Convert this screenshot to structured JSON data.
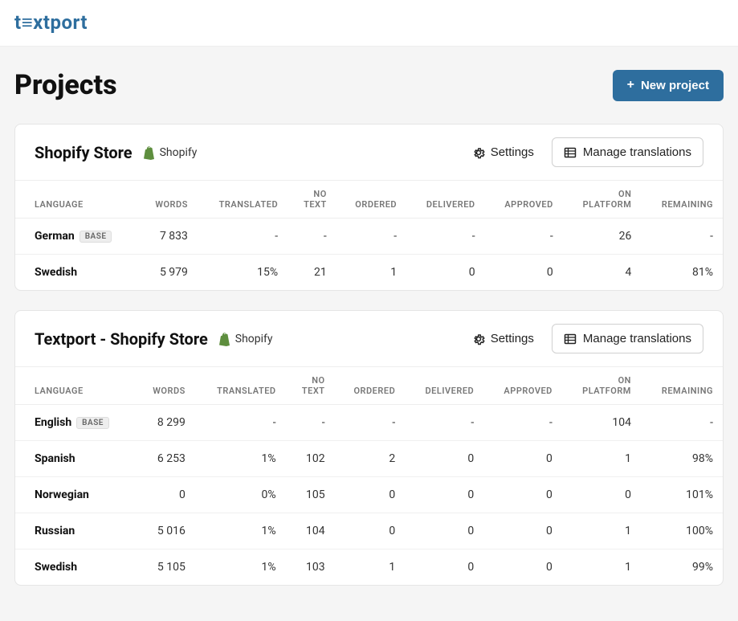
{
  "brand": "t≡xtport",
  "page_title": "Projects",
  "new_project_label": "New project",
  "settings_label": "Settings",
  "manage_label": "Manage translations",
  "base_badge": "BASE",
  "columns": {
    "language": "LANGUAGE",
    "words": "WORDS",
    "translated": "TRANSLATED",
    "no_text": "NO TEXT",
    "ordered": "ORDERED",
    "delivered": "DELIVERED",
    "approved": "APPROVED",
    "on_platform": "ON PLATFORM",
    "remaining": "REMAINING"
  },
  "projects": [
    {
      "title": "Shopify Store",
      "platform": "Shopify",
      "rows": [
        {
          "language": "German",
          "base": true,
          "words": "7 833",
          "translated": "-",
          "no_text": "-",
          "ordered": "-",
          "delivered": "-",
          "approved": "-",
          "on_platform": "26",
          "remaining": "-"
        },
        {
          "language": "Swedish",
          "base": false,
          "words": "5 979",
          "translated": "15%",
          "no_text": "21",
          "ordered": "1",
          "delivered": "0",
          "approved": "0",
          "on_platform": "4",
          "remaining": "81%"
        }
      ]
    },
    {
      "title": "Textport - Shopify Store",
      "platform": "Shopify",
      "rows": [
        {
          "language": "English",
          "base": true,
          "words": "8 299",
          "translated": "-",
          "no_text": "-",
          "ordered": "-",
          "delivered": "-",
          "approved": "-",
          "on_platform": "104",
          "remaining": "-"
        },
        {
          "language": "Spanish",
          "base": false,
          "words": "6 253",
          "translated": "1%",
          "no_text": "102",
          "ordered": "2",
          "delivered": "0",
          "approved": "0",
          "on_platform": "1",
          "remaining": "98%"
        },
        {
          "language": "Norwegian",
          "base": false,
          "words": "0",
          "translated": "0%",
          "no_text": "105",
          "ordered": "0",
          "delivered": "0",
          "approved": "0",
          "on_platform": "0",
          "remaining": "101%"
        },
        {
          "language": "Russian",
          "base": false,
          "words": "5 016",
          "translated": "1%",
          "no_text": "104",
          "ordered": "0",
          "delivered": "0",
          "approved": "0",
          "on_platform": "1",
          "remaining": "100%"
        },
        {
          "language": "Swedish",
          "base": false,
          "words": "5 105",
          "translated": "1%",
          "no_text": "103",
          "ordered": "1",
          "delivered": "0",
          "approved": "0",
          "on_platform": "1",
          "remaining": "99%"
        }
      ]
    }
  ]
}
